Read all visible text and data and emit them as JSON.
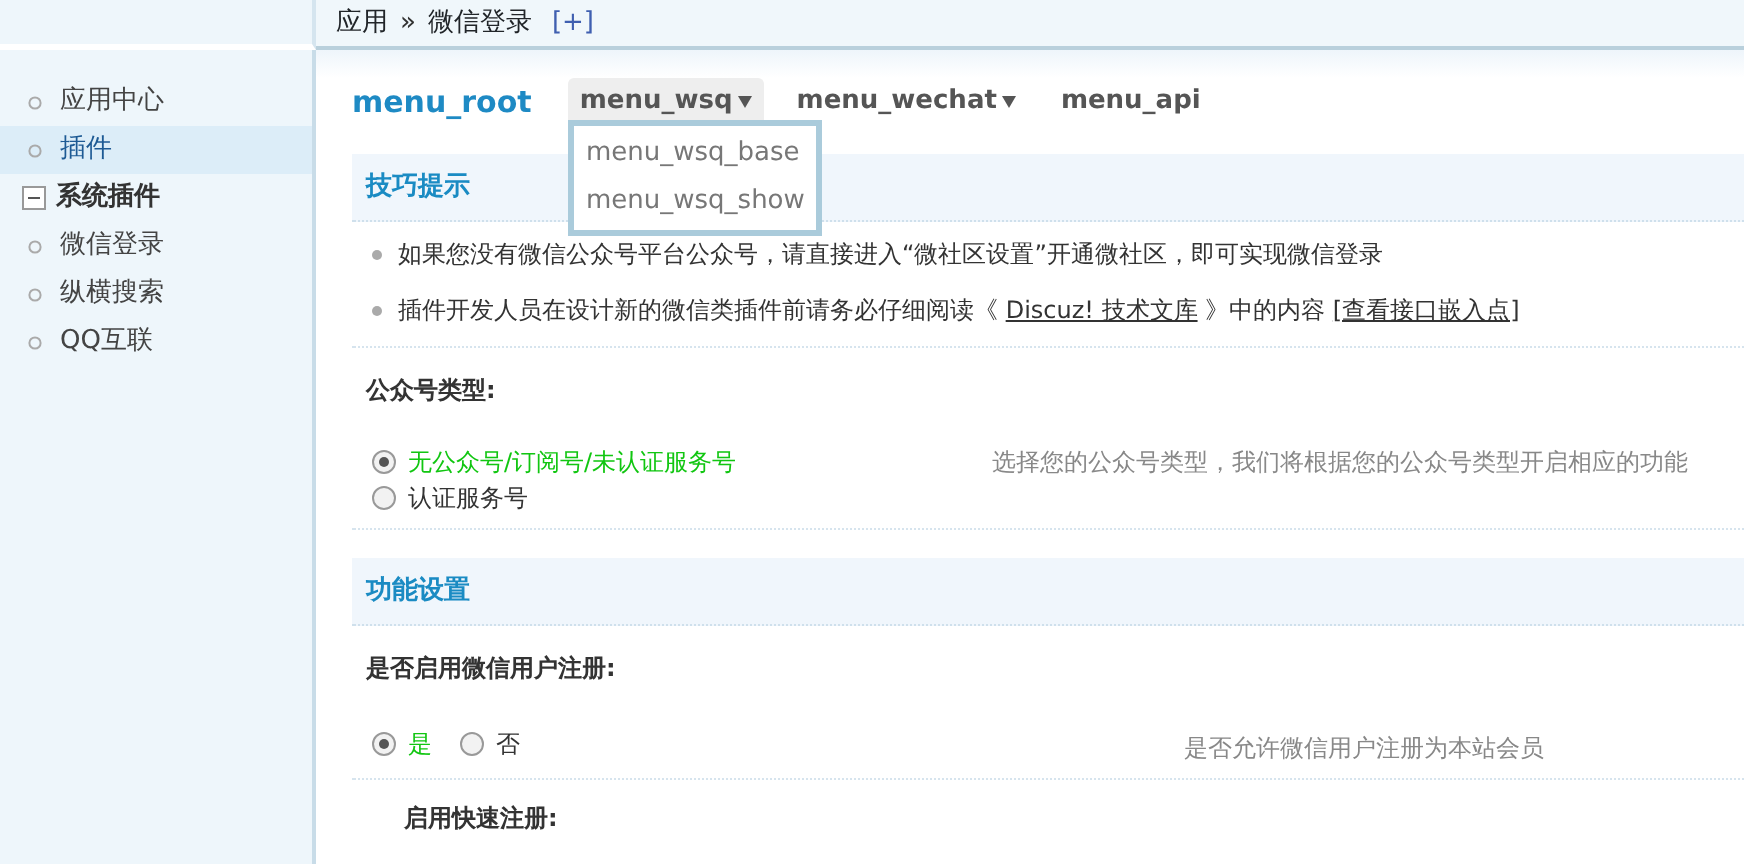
{
  "breadcrumb": {
    "items": [
      "应用",
      "微信登录"
    ],
    "separator": "»",
    "action": "[+]"
  },
  "sidebar": {
    "items": [
      {
        "kind": "link",
        "label": "应用中心",
        "selected": false
      },
      {
        "kind": "link",
        "label": "插件",
        "selected": true
      },
      {
        "kind": "group",
        "label": "系统插件",
        "expanded": true,
        "children": [
          {
            "kind": "link",
            "label": "微信登录",
            "selected": false
          },
          {
            "kind": "link",
            "label": "纵横搜索",
            "selected": false
          },
          {
            "kind": "link",
            "label": "QQ互联",
            "selected": false
          }
        ]
      }
    ]
  },
  "menu": {
    "root": "menu_root",
    "tabs": [
      {
        "label": "menu_wsq",
        "has_dropdown": true,
        "selected": true
      },
      {
        "label": "menu_wechat",
        "has_dropdown": true,
        "selected": false
      },
      {
        "label": "menu_api",
        "has_dropdown": false,
        "selected": false
      }
    ],
    "dropdown": [
      "menu_wsq_base",
      "menu_wsq_show"
    ]
  },
  "sections": [
    {
      "kind": "header",
      "title": "技巧提示"
    },
    {
      "kind": "tips",
      "items": [
        [
          {
            "kind": "text",
            "text": "如果您没有微信公众号平台公众号，请直接进入“微社区设置”开通微社区，即可实现微信登录"
          }
        ],
        [
          {
            "kind": "text",
            "text": "插件开发人员在设计新的微信类插件前请务必仔细阅读《 "
          },
          {
            "kind": "link",
            "text": "Discuz! 技术文库"
          },
          {
            "kind": "text",
            "text": " 》中的内容 "
          },
          {
            "kind": "link",
            "text": "[查看接口嵌入点]"
          }
        ]
      ]
    },
    {
      "kind": "radiolist",
      "label": "公众号类型:",
      "options": [
        {
          "label": "无公众号/订阅号/未认证服务号",
          "selected": true
        },
        {
          "label": "认证服务号",
          "selected": false
        }
      ],
      "hint": "选择您的公众号类型，我们将根据您的公众号类型开启相应的功能"
    },
    {
      "kind": "header",
      "title": "功能设置"
    },
    {
      "kind": "radiorow",
      "label": "是否启用微信用户注册:",
      "options": [
        {
          "label": "是",
          "selected": true
        },
        {
          "label": "否",
          "selected": false
        }
      ],
      "hint": "是否允许微信用户注册为本站会员",
      "children": [
        {
          "kind": "setting",
          "label": "启用快速注册:"
        }
      ]
    }
  ]
}
